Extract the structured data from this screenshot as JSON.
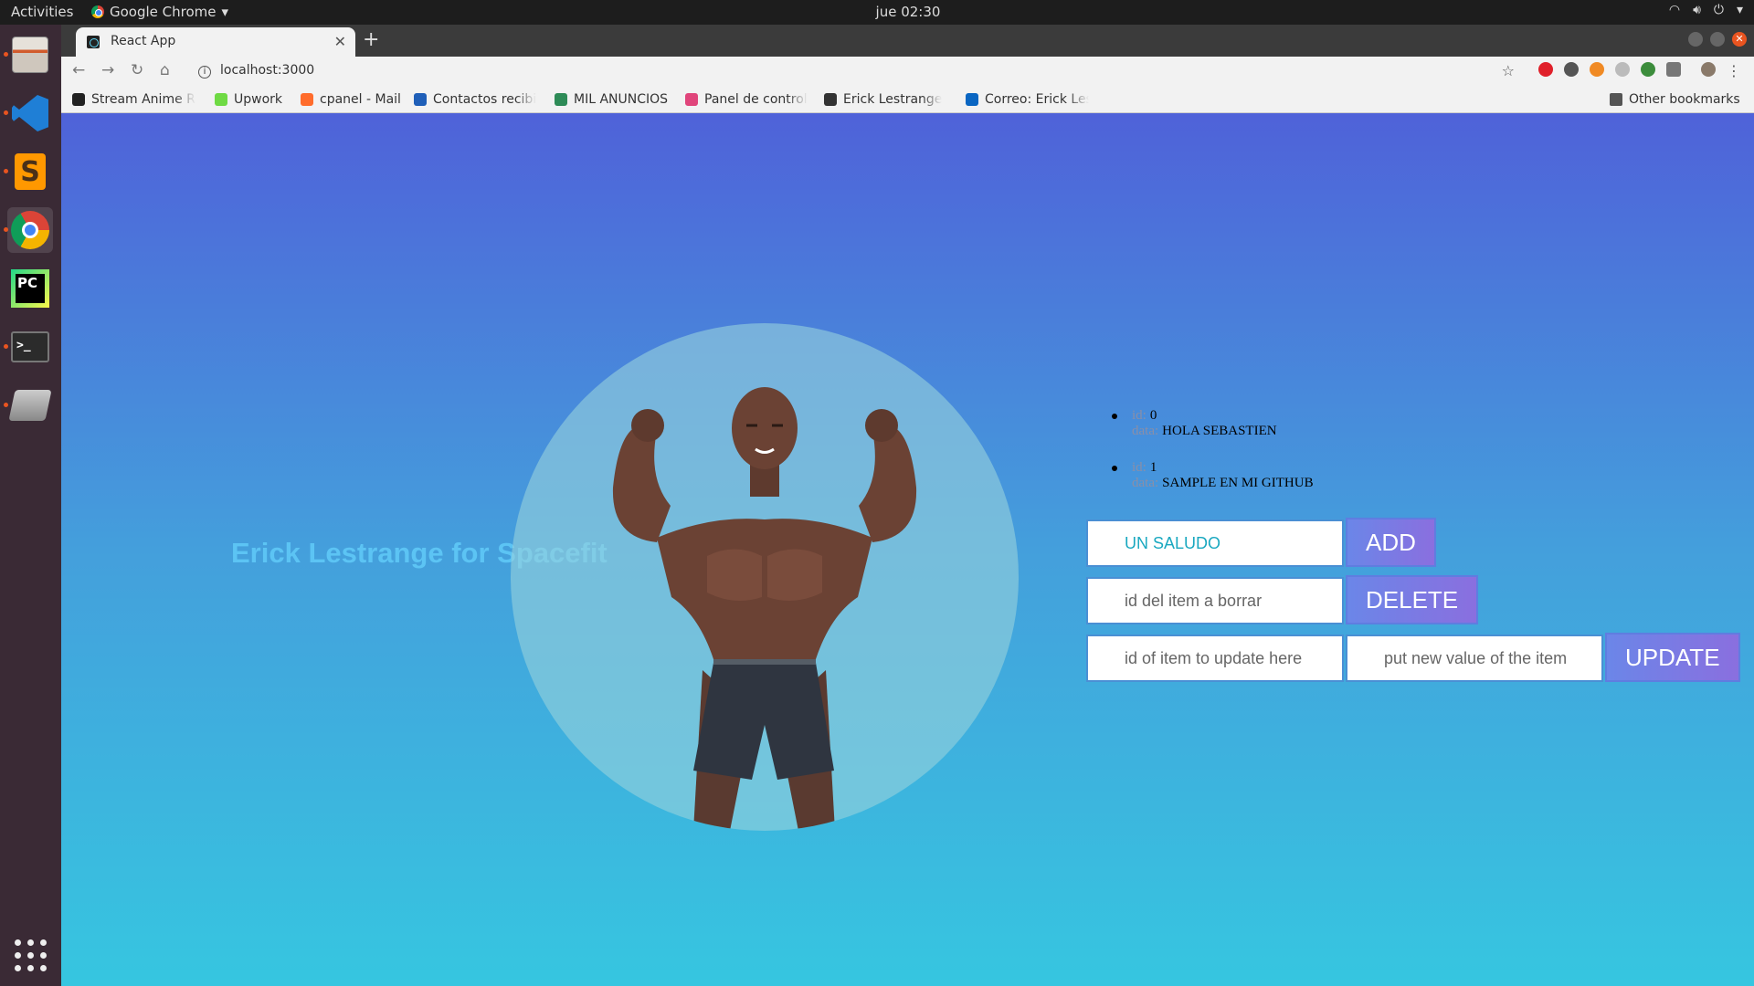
{
  "topbar": {
    "activities": "Activities",
    "app": "Google Chrome",
    "clock": "jue 02:30"
  },
  "browser": {
    "tab_title": "React App",
    "url": "localhost:3000",
    "bookmarks": [
      {
        "label": "Stream Anime R",
        "color": "#222222"
      },
      {
        "label": "Upwork",
        "color": "#6fda44"
      },
      {
        "label": "cpanel - Mail",
        "color": "#ff6c2c"
      },
      {
        "label": "Contactos recibi",
        "color": "#1f5fb8"
      },
      {
        "label": "MIL ANUNCIOS",
        "color": "#2e8b57"
      },
      {
        "label": "Panel de control",
        "color": "#e0457b"
      },
      {
        "label": "Erick Lestrange",
        "color": "#333333"
      },
      {
        "label": "Correo: Erick Les",
        "color": "#0a66c2"
      }
    ],
    "other_bookmarks": "Other bookmarks"
  },
  "app": {
    "brand": "Erick Lestrange for Spacefit",
    "id_label": "id:",
    "data_label": "data:",
    "items": [
      {
        "id": "0",
        "data": "HOLA SEBASTIEN"
      },
      {
        "id": "1",
        "data": "SAMPLE EN MI GITHUB"
      }
    ],
    "add_input_value": "UN SALUDO",
    "add_button": "ADD",
    "delete_placeholder": "id del item a borrar",
    "delete_button": "DELETE",
    "update_id_placeholder": "id of item to update here",
    "update_value_placeholder": "put new value of the item",
    "update_button": "UPDATE"
  },
  "colors": {
    "gradient_top": "#4f62d9",
    "gradient_bottom": "#36c6e0",
    "brand_text": "#5cc4f4",
    "button": "#7a7ae6"
  }
}
